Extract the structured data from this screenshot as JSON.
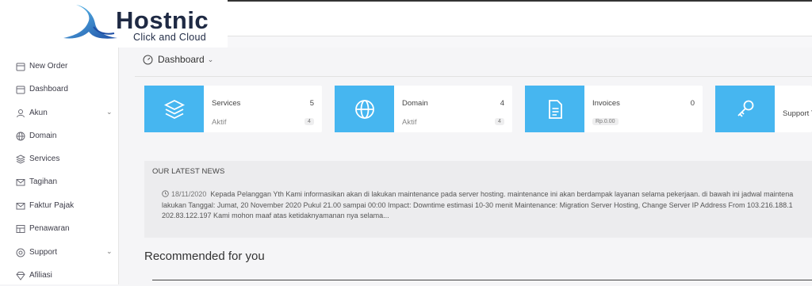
{
  "brand": {
    "name": "Hostnic",
    "tagline": "Click and Cloud"
  },
  "sidebar": {
    "items": [
      {
        "label": "New Order",
        "icon": "calendar-icon",
        "expandable": false
      },
      {
        "label": "Dashboard",
        "icon": "calendar-icon",
        "expandable": false
      },
      {
        "label": "Akun",
        "icon": "user-icon",
        "expandable": true
      },
      {
        "label": "Domain",
        "icon": "globe-icon",
        "expandable": false
      },
      {
        "label": "Services",
        "icon": "layers-icon",
        "expandable": false
      },
      {
        "label": "Tagihan",
        "icon": "mail-icon",
        "expandable": false
      },
      {
        "label": "Faktur Pajak",
        "icon": "mail-icon",
        "expandable": false
      },
      {
        "label": "Penawaran",
        "icon": "table-icon",
        "expandable": false
      },
      {
        "label": "Support",
        "icon": "lifebuoy-icon",
        "expandable": true
      },
      {
        "label": "Afiliasi",
        "icon": "diamond-icon",
        "expandable": false
      }
    ]
  },
  "main": {
    "title": "Dashboard",
    "cards": [
      {
        "name": "Services",
        "count": "5",
        "sub": "Aktif",
        "pill": "4",
        "icon": "layers-icon"
      },
      {
        "name": "Domain",
        "count": "4",
        "sub": "Aktif",
        "pill": "4",
        "icon": "globe-icon"
      },
      {
        "name": "Invoices",
        "count": "0",
        "sub": "",
        "pill": "Rp.0.00",
        "icon": "document-icon"
      },
      {
        "name": "Support T",
        "count": "",
        "sub": "",
        "pill": "",
        "icon": "key-icon"
      }
    ],
    "news": {
      "title": "OUR LATEST NEWS",
      "date": "18/11/2020",
      "line1": "Kepada Pelanggan Yth Kami informasikan akan di lakukan maintenance pada server hosting. maintenance ini akan berdampak layanan selama pekerjaan. di bawah ini jadwal maintena",
      "line2": "lakukan Tanggal: Jumat,  20 November 2020 Pukul 21.00 sampai 00:00 Impact: Downtime estimasi 10-30 menit Maintenance: Migration Server Hosting, Change Server IP Address From 103.216.188.1",
      "line3": "202.83.122.197   Kami mohon maaf atas ketidaknyamanan nya selama..."
    },
    "recommended": "Recommended for you"
  },
  "colors": {
    "tile": "#46b6f0",
    "brand": "#1f2a44",
    "wave_light": "#5cc2f0",
    "wave_dark": "#1f4fa5"
  }
}
